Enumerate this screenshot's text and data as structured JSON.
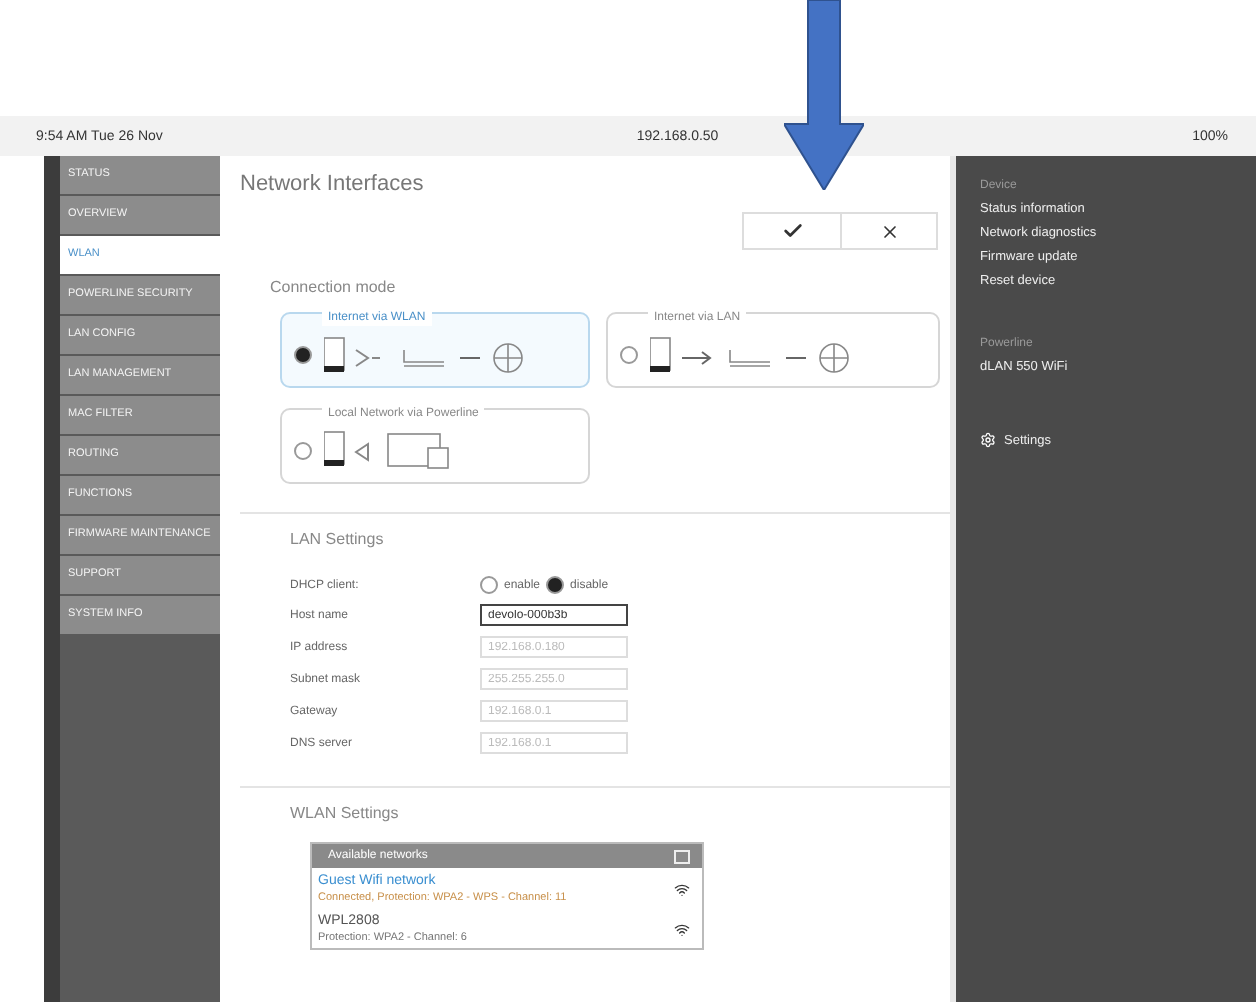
{
  "status_bar": {
    "time": "9:54 AM  Tue 26 Nov",
    "url": "192.168.0.50",
    "battery": "100%"
  },
  "sidebar": {
    "items": [
      {
        "label": "STATUS",
        "selected": false
      },
      {
        "label": "OVERVIEW",
        "selected": false
      },
      {
        "label": "WLAN",
        "selected": true
      },
      {
        "label": "POWERLINE SECURITY",
        "selected": false
      },
      {
        "label": "LAN CONFIG",
        "selected": false
      },
      {
        "label": "LAN MANAGEMENT",
        "selected": false
      },
      {
        "label": "MAC FILTER",
        "selected": false
      },
      {
        "label": "ROUTING",
        "selected": false
      },
      {
        "label": "FUNCTIONS",
        "selected": false
      },
      {
        "label": "FIRMWARE MAINTENANCE",
        "selected": false
      },
      {
        "label": "SUPPORT",
        "selected": false
      },
      {
        "label": "SYSTEM INFO",
        "selected": false
      }
    ]
  },
  "main": {
    "title": "Network Interfaces",
    "connection": {
      "title": "Connection mode",
      "options": [
        {
          "label": "Internet via WLAN",
          "kind": "wifi",
          "selected": true
        },
        {
          "label": "Internet via LAN",
          "kind": "lan",
          "selected": false
        },
        {
          "label": "Local Network via Powerline",
          "kind": "powerline",
          "selected": false
        }
      ]
    },
    "lan": {
      "title": "LAN Settings",
      "dhcp": {
        "label": "DHCP client:",
        "options": [
          {
            "label": "enable",
            "selected": false
          },
          {
            "label": "disable",
            "selected": true
          }
        ]
      },
      "fields": [
        {
          "label": "Host name",
          "value": "devolo-000b3b",
          "disabled": false
        },
        {
          "label": "IP address",
          "value": "192.168.0.180",
          "disabled": true
        },
        {
          "label": "Subnet mask",
          "value": "255.255.255.0",
          "disabled": true
        },
        {
          "label": "Gateway",
          "value": "192.168.0.1",
          "disabled": true
        },
        {
          "label": "DNS server",
          "value": "192.168.0.1",
          "disabled": true
        }
      ]
    },
    "wlan": {
      "title": "WLAN Settings",
      "list_title": "Available networks",
      "networks": [
        {
          "name": "Guest Wifi network",
          "detail": "Connected, Protection: WPA2 - WPS - Channel: 11",
          "selected": true
        },
        {
          "name": "WPL2808",
          "detail": "Protection: WPA2 - Channel: 6",
          "selected": false
        }
      ]
    }
  },
  "right_panel": {
    "heading": "Device",
    "links": [
      "Status information",
      "Network diagnostics",
      "Firmware update",
      "Reset device"
    ],
    "device_heading": "Powerline",
    "device_name": "dLAN 550 WiFi",
    "settings": "Settings"
  }
}
